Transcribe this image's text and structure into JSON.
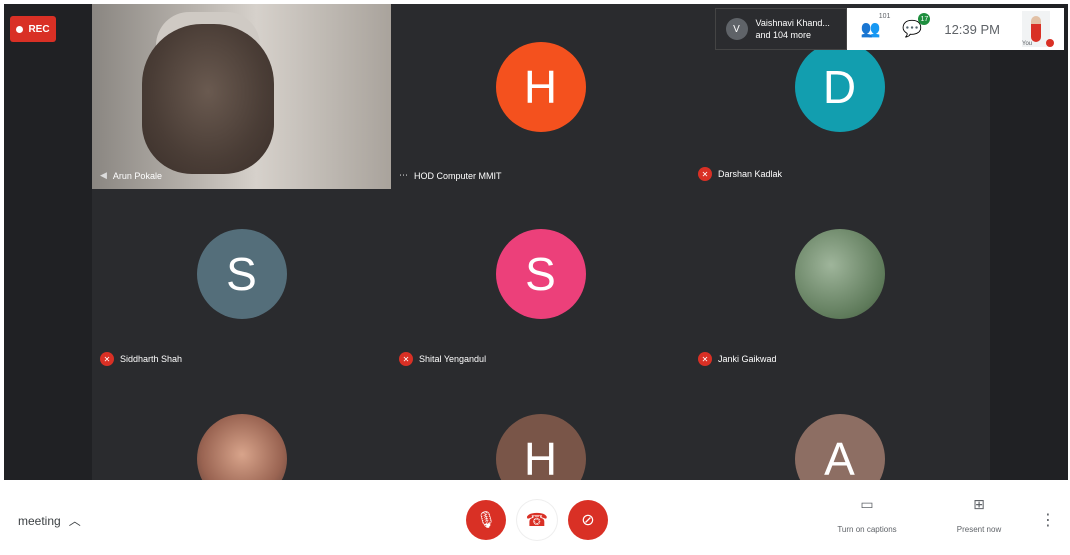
{
  "recording": {
    "label": "REC"
  },
  "topbar": {
    "participants_name": "Vaishnavi Khand...",
    "participants_more": "and 104 more",
    "participants_count": "101",
    "chat_badge": "17",
    "time": "12:39 PM",
    "self_label": "You"
  },
  "tiles": [
    {
      "name": "Arun Pokale",
      "type": "video"
    },
    {
      "name": "HOD Computer MMIT",
      "type": "avatar",
      "letter": "H",
      "color": "#f4511e"
    },
    {
      "name": "Darshan Kadlak",
      "type": "avatar",
      "letter": "D",
      "color": "#129eaf"
    },
    {
      "name": "Siddharth Shah",
      "type": "avatar",
      "letter": "S",
      "color": "#546e7a"
    },
    {
      "name": "Shital Yengandul",
      "type": "avatar",
      "letter": "S",
      "color": "#ec407a"
    },
    {
      "name": "Janki Gaikwad",
      "type": "photo"
    },
    {
      "name": "",
      "type": "photo2"
    },
    {
      "name": "",
      "type": "avatar",
      "letter": "H",
      "color": "#795548"
    },
    {
      "name": "",
      "type": "avatar",
      "letter": "A",
      "color": "#8d6e63"
    }
  ],
  "bottom": {
    "meeting_details": "meeting",
    "captions_label": "Turn on captions",
    "present_label": "Present now"
  }
}
